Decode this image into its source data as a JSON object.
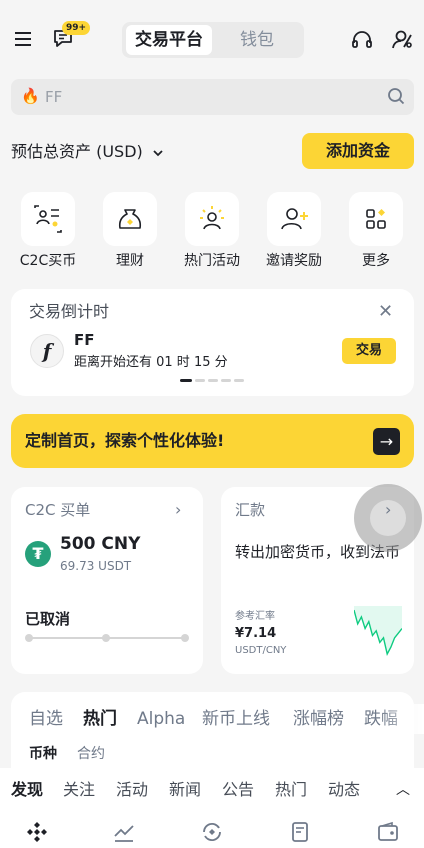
{
  "header": {
    "badge": "99+",
    "segment_active": "交易平台",
    "segment_inactive": "钱包"
  },
  "search": {
    "placeholder": "FF",
    "fire_icon": "🔥"
  },
  "assets": {
    "label": "预估总资产 (USD)",
    "add_funds": "添加资金"
  },
  "shortcuts": [
    {
      "label": "C2C买币",
      "icon": "c2c-icon"
    },
    {
      "label": "理财",
      "icon": "earn-icon"
    },
    {
      "label": "热门活动",
      "icon": "hot-activity-icon"
    },
    {
      "label": "邀请奖励",
      "icon": "invite-icon"
    },
    {
      "label": "更多",
      "icon": "more-icon"
    }
  ],
  "countdown": {
    "title": "交易倒计时",
    "close": "✕",
    "logo": "f",
    "coin": "FF",
    "desc": "距离开始还有 01 时 15 分",
    "trade": "交易"
  },
  "banner": {
    "text": "定制首页，探索个性化体验!",
    "arrow": "→"
  },
  "c2c": {
    "title": "C2C 买单",
    "chevron": "›",
    "coin_symbol": "₮",
    "amount": "500 CNY",
    "sub": "69.73 USDT",
    "status": "已取消",
    "progress_steps": 3
  },
  "remit": {
    "title": "汇款",
    "chevron": "›",
    "text": "转出加密货币，收到法币",
    "ref_label": "参考汇率",
    "rate": "¥7.14",
    "pair": "USDT/CNY",
    "spark_color": "#0ecb81",
    "sparkline": [
      6,
      18,
      12,
      22,
      16,
      28,
      24,
      34,
      30,
      44,
      38,
      30,
      26,
      22
    ]
  },
  "market_tabs": [
    "自选",
    "热门",
    "Alpha",
    "新币上线",
    "涨幅榜",
    "跌幅"
  ],
  "market_subtabs": [
    "币种",
    "合约"
  ],
  "feed_tabs": [
    "发现",
    "关注",
    "活动",
    "新闻",
    "公告",
    "热门",
    "动态"
  ],
  "feed_toggle": "︿",
  "colors": {
    "accent": "#fcd535",
    "text": "#1e2026",
    "muted": "#707a8a",
    "up": "#0ecb81",
    "tether": "#26a17b"
  },
  "nav_icons": [
    "home-icon",
    "markets-icon",
    "trade-icon",
    "futures-icon",
    "assets-icon"
  ]
}
